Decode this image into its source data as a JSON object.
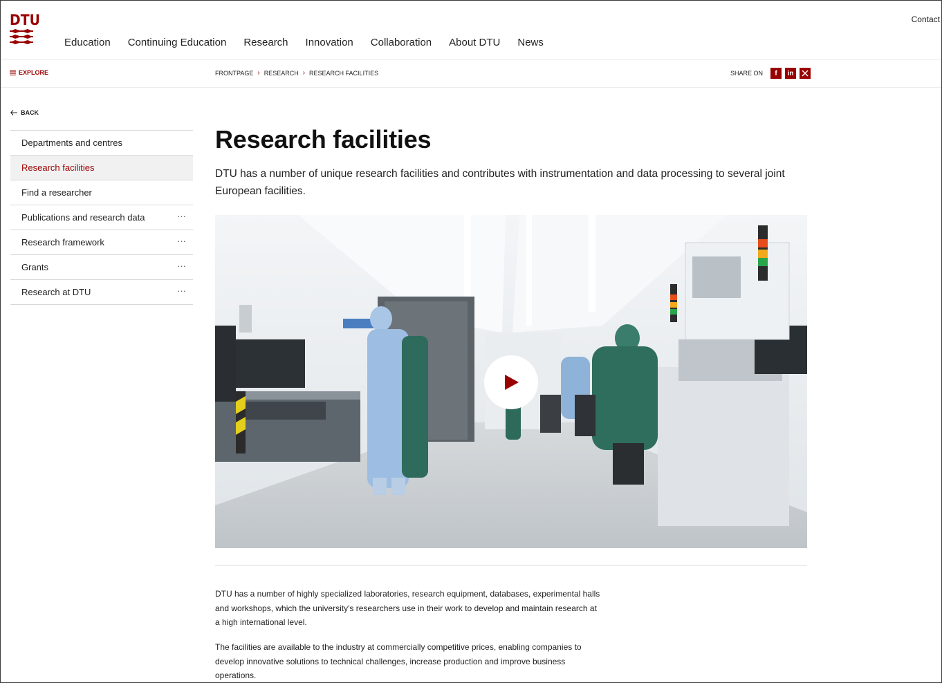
{
  "brand": {
    "name": "DTU",
    "accent": "#990000"
  },
  "header": {
    "contact_label": "Contact",
    "nav": [
      "Education",
      "Continuing Education",
      "Research",
      "Innovation",
      "Collaboration",
      "About DTU",
      "News"
    ]
  },
  "subbar": {
    "explore_label": "EXPLORE",
    "breadcrumb": [
      "FRONTPAGE",
      "RESEARCH",
      "RESEARCH FACILITIES"
    ],
    "share_label": "SHARE ON",
    "share_icons": [
      "facebook-icon",
      "linkedin-icon",
      "x-icon"
    ]
  },
  "sidebar": {
    "back_label": "BACK",
    "items": [
      {
        "label": "Departments and centres",
        "active": false,
        "has_more": false
      },
      {
        "label": "Research facilities",
        "active": true,
        "has_more": false
      },
      {
        "label": "Find a researcher",
        "active": false,
        "has_more": false
      },
      {
        "label": "Publications and research data",
        "active": false,
        "has_more": true
      },
      {
        "label": "Research framework",
        "active": false,
        "has_more": true
      },
      {
        "label": "Grants",
        "active": false,
        "has_more": true
      },
      {
        "label": "Research at DTU",
        "active": false,
        "has_more": true
      }
    ],
    "more_glyph": "···"
  },
  "main": {
    "title": "Research facilities",
    "lead": "DTU has a number of unique research facilities and contributes with instrumentation and data processing to several joint European facilities.",
    "video": {
      "play_icon": "play-icon"
    },
    "paragraphs": [
      "DTU has a number of highly specialized laboratories, research equipment, databases, experimental halls and workshops, which the university's researchers use in their work to develop and maintain research at a high international level.",
      "The facilities are available to the industry at commercially competitive prices, enabling companies to develop innovative solutions to technical challenges, increase production and improve business operations."
    ]
  }
}
